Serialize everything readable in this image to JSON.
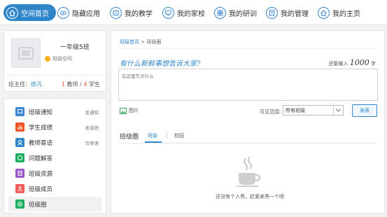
{
  "nav": {
    "items": [
      {
        "label": "空间首页",
        "icon": "home-icon"
      },
      {
        "label": "隐藏应用",
        "icon": "eye-icon"
      },
      {
        "label": "我的教学",
        "icon": "teaching-icon"
      },
      {
        "label": "我的家校",
        "icon": "monitor-icon"
      },
      {
        "label": "我的研训",
        "icon": "grid-icon"
      },
      {
        "label": "我的管理",
        "icon": "document-icon"
      },
      {
        "label": "我的主页",
        "icon": "house-icon"
      }
    ],
    "active_color": "#2f86c9"
  },
  "class_card": {
    "class_name": "一年级5班",
    "space_link": "班级空间",
    "teacher_label": "班主任：",
    "teacher_name": "徐凡",
    "teacher_count": "1",
    "teacher_unit": "教师",
    "separator": " / ",
    "student_count": "4",
    "student_unit": "学生"
  },
  "menu": {
    "items": [
      {
        "label": "班级通知",
        "action": "发通知",
        "color": "#3b86d0",
        "icon": "notice-icon"
      },
      {
        "label": "学生成绩",
        "action": "发成绩",
        "color": "#f0552a",
        "icon": "bar-chart-icon"
      },
      {
        "label": "教师寄语",
        "action": "写寄语",
        "color": "#2f86c9",
        "icon": "message-icon"
      },
      {
        "label": "问题解答",
        "action": "",
        "color": "#1fae5e",
        "icon": "question-icon"
      },
      {
        "label": "班级资源",
        "action": "",
        "color": "#9b59c8",
        "icon": "resource-icon"
      },
      {
        "label": "班级成员",
        "action": "",
        "color": "#f15a5a",
        "icon": "member-icon"
      },
      {
        "label": "班级圈",
        "action": "",
        "color": "#1fae5e",
        "icon": "circle-icon"
      }
    ]
  },
  "main": {
    "breadcrumb_home": "班级首页",
    "breadcrumb_sep": " > ",
    "breadcrumb_current": "班级圈",
    "prompt": "有什么新鲜事想告诉大家?",
    "remain_prefix": "还能输入",
    "remain_count": "1000",
    "remain_suffix": "字",
    "textarea_placeholder": "在这里写点什么",
    "picture_label": "图片",
    "scope_label": "可见范围:",
    "scope_value": "所有班级",
    "publish_label": "发表",
    "section_title": "班级圈",
    "tab_class": "班级",
    "tab_school": "校园",
    "empty_text": "还没有个人秀，赶紧来秀一个吧"
  }
}
